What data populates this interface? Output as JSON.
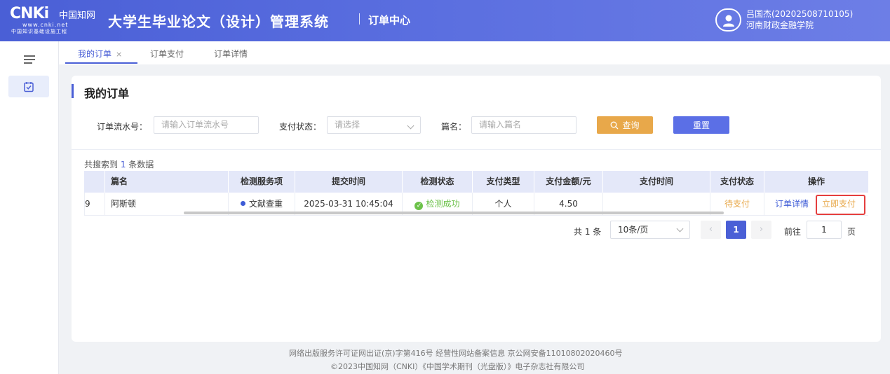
{
  "header": {
    "logo_mark": "CNKi",
    "logo_cn": "中国知网",
    "logo_url": "www.cnki.net",
    "logo_subtitle": "中国知识基础设施工程",
    "title": "大学生毕业论文（设计）管理系统",
    "subtitle": "订单中心",
    "user_name": "吕国杰(20202508710105)",
    "user_school": "河南财政金融学院"
  },
  "tabs": [
    {
      "label": "我的订单",
      "active": true,
      "close": "×"
    },
    {
      "label": "订单支付",
      "active": false
    },
    {
      "label": "订单详情",
      "active": false
    }
  ],
  "card": {
    "title": "我的订单",
    "filters": {
      "order_no_label": "订单流水号：",
      "order_no_placeholder": "请输入订单流水号",
      "pay_status_label": "支付状态：",
      "pay_status_placeholder": "请选择",
      "title_label": "篇名：",
      "title_placeholder": "请输入篇名",
      "search_button": "查询",
      "reset_button": "重置"
    },
    "result": {
      "prefix": "共搜索到 ",
      "count": "1",
      "suffix": " 条数据"
    },
    "table": {
      "headers": [
        "篇名",
        "检测服务项",
        "提交时间",
        "检测状态",
        "支付类型",
        "支付金额/元",
        "支付时间",
        "支付状态",
        "操作"
      ],
      "rows": [
        {
          "index": "9",
          "title": "阿斯顿",
          "service": "文献查重",
          "submit_time": "2025-03-31 10:45:04",
          "check_status": "检测成功",
          "pay_type": "个人",
          "amount": "4.50",
          "pay_time": "",
          "pay_status": "待支付",
          "action_detail": "订单详情",
          "action_pay": "立即支付"
        }
      ]
    },
    "pagination": {
      "total": "共 1 条",
      "page_size": "10条/页",
      "prev": "‹",
      "current": "1",
      "next": "›",
      "goto_label": "前往",
      "goto_value": "1",
      "page_suffix": "页"
    }
  },
  "footer": {
    "line1": "网络出版服务许可证网出证(京)字第416号  经营性网站备案信息  京公网安备11010802020460号",
    "line2": "©2023中国知网（CNKI）《中国学术期刊（光盘版）》电子杂志社有限公司"
  },
  "colors": {
    "primary": "#4a5fd6",
    "warning": "#e8a84a",
    "success": "#6cc24a",
    "highlight": "#e53e3e"
  }
}
